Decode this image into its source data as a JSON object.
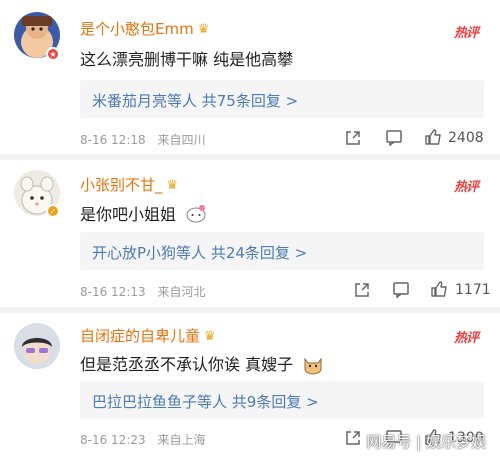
{
  "comments": [
    {
      "username": "是个小憨包Emm",
      "hot": "热评",
      "text": "这么漂亮删博干嘛 纯是他高攀",
      "replies": "米番茄月亮等人 共75条回复 >",
      "date": "8-16 12:18",
      "location": "来自四川",
      "likes": "2408"
    },
    {
      "username": "小张别不甘_",
      "hot": "热评",
      "text": "是你吧小姐姐",
      "replies": "开心放P小狗等人 共24条回复 >",
      "date": "8-16 12:13",
      "location": "来自河北",
      "likes": "1171"
    },
    {
      "username": "自闭症的自卑儿童",
      "hot": "热评",
      "text": "但是范丞丞不承认你诶 真嫂子",
      "replies": "巴拉巴拉鱼鱼子等人 共9条回复 >",
      "date": "8-16 12:23",
      "location": "来自上海",
      "likes": "1300"
    }
  ],
  "watermark": "网易号 | 娱乐梦娱",
  "colors": {
    "username": "#e8730c",
    "hot": "#ef3f3f",
    "reply_link": "#4b7bb8",
    "meta": "#9b9b9b"
  },
  "icons": [
    "crown-icon",
    "share-icon",
    "comment-icon",
    "like-icon",
    "verified-badge-icon"
  ]
}
